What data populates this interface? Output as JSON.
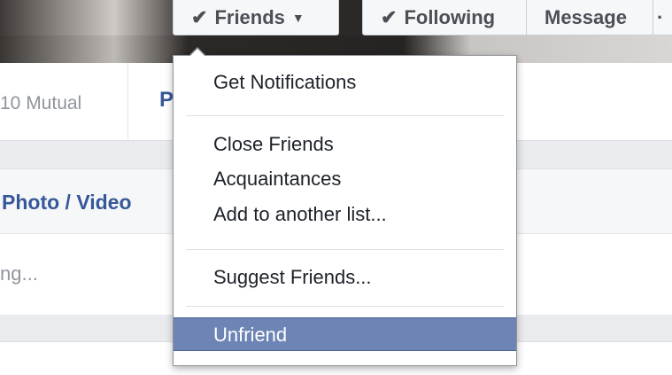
{
  "header": {
    "friends_button": {
      "check": "✔",
      "label": "Friends",
      "caret": "▼"
    },
    "following_button": {
      "check": "✔",
      "label": "Following"
    },
    "message_button": {
      "label": "Message"
    },
    "more_button": {
      "label": "·"
    }
  },
  "navbar": {
    "mutual": "10 Mutual",
    "tab_partial": "P"
  },
  "composer": {
    "photo_video": "Photo / Video",
    "placeholder": "ng..."
  },
  "menu": {
    "items": [
      {
        "label": "Get Notifications"
      },
      {
        "label": "Close Friends"
      },
      {
        "label": "Acquaintances"
      },
      {
        "label": "Add to another list..."
      },
      {
        "label": "Suggest Friends..."
      },
      {
        "label": "Unfriend"
      }
    ]
  },
  "colors": {
    "link": "#365899",
    "highlight": "#6d84b4"
  }
}
